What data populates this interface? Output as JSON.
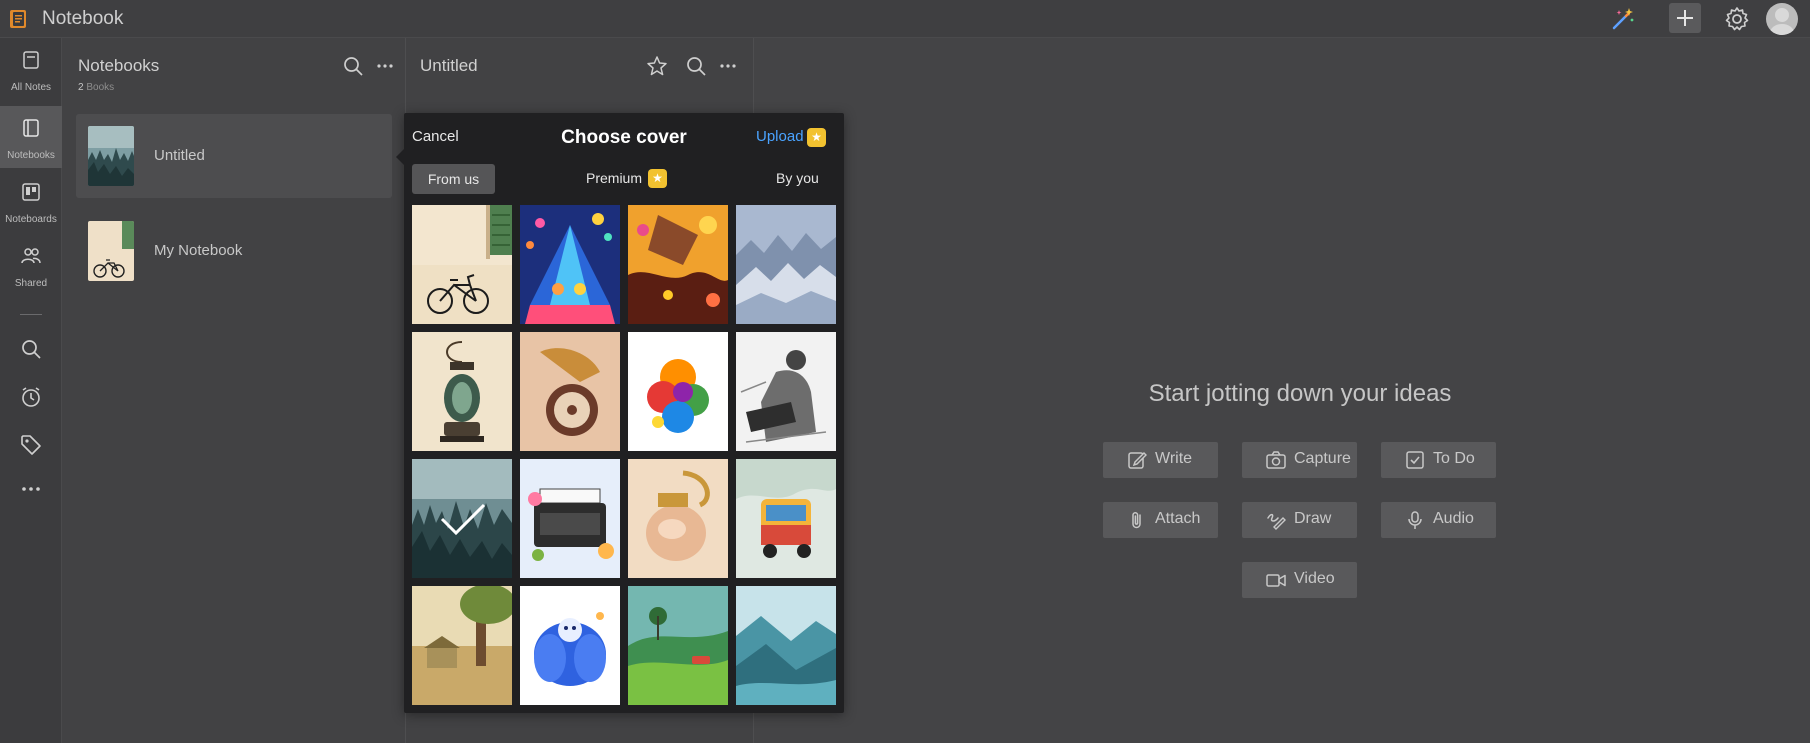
{
  "app": {
    "title": "Notebook"
  },
  "rail": {
    "items": [
      {
        "label": "All Notes"
      },
      {
        "label": "Notebooks"
      },
      {
        "label": "Noteboards"
      },
      {
        "label": "Shared"
      }
    ]
  },
  "notebooks": {
    "title": "Notebooks",
    "count": "2",
    "count_unit": "Books",
    "items": [
      {
        "name": "Untitled"
      },
      {
        "name": "My Notebook"
      }
    ]
  },
  "notes": {
    "title": "Untitled"
  },
  "empty": {
    "title": "Start jotting down your ideas",
    "actions": [
      {
        "label": "Write",
        "icon": "pencil-icon"
      },
      {
        "label": "Capture",
        "icon": "camera-icon"
      },
      {
        "label": "To Do",
        "icon": "checkbox-icon"
      },
      {
        "label": "Attach",
        "icon": "paperclip-icon"
      },
      {
        "label": "Draw",
        "icon": "draw-icon"
      },
      {
        "label": "Audio",
        "icon": "microphone-icon"
      },
      {
        "label": "Video",
        "icon": "video-icon"
      }
    ]
  },
  "cover_picker": {
    "cancel": "Cancel",
    "title": "Choose cover",
    "upload": "Upload",
    "tabs": [
      "From us",
      "Premium",
      "By you"
    ],
    "selected_index": 8
  },
  "colors": {
    "accent_link": "#4aa3ff",
    "premium_badge": "#f2c230",
    "background": "#444446"
  }
}
